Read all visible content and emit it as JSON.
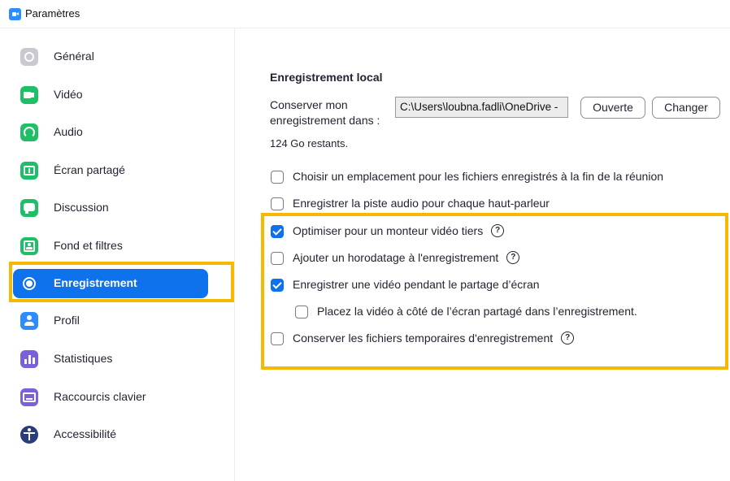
{
  "window": {
    "title": "Paramètres"
  },
  "sidebar": {
    "items": [
      {
        "label": "Général",
        "icon": "gear-icon",
        "color": "#c9c9cf"
      },
      {
        "label": "Vidéo",
        "icon": "video-camera-icon",
        "color": "#1fbf68"
      },
      {
        "label": "Audio",
        "icon": "headphones-icon",
        "color": "#1fbf68"
      },
      {
        "label": "Écran partagé",
        "icon": "share-screen-icon",
        "color": "#1fbf68"
      },
      {
        "label": "Discussion",
        "icon": "chat-bubble-icon",
        "color": "#1fbf68"
      },
      {
        "label": "Fond et filtres",
        "icon": "background-person-icon",
        "color": "#1fbf68"
      },
      {
        "label": "Enregistrement",
        "icon": "record-icon",
        "color": "#0e72ed",
        "active": true
      },
      {
        "label": "Profil",
        "icon": "profile-icon",
        "color": "#2d8cff"
      },
      {
        "label": "Statistiques",
        "icon": "statistics-icon",
        "color": "#7b61d9"
      },
      {
        "label": "Raccourcis clavier",
        "icon": "keyboard-icon",
        "color": "#7b61d9"
      },
      {
        "label": "Accessibilité",
        "icon": "accessibility-icon",
        "color": "#2a3c7a"
      }
    ]
  },
  "recording": {
    "section_title": "Enregistrement local",
    "save_location_label": "Conserver mon enregistrement dans :",
    "save_path": "C:\\Users\\loubna.fadli\\OneDrive -",
    "open_button": "Ouverte",
    "change_button": "Changer",
    "space_remaining": "124 Go restants.",
    "options": [
      {
        "label": "Choisir un emplacement pour les fichiers enregistrés à la fin de la réunion",
        "checked": false,
        "help": false
      },
      {
        "label": "Enregistrer la piste audio pour chaque haut-parleur",
        "checked": false,
        "help": false
      },
      {
        "label": "Optimiser pour un monteur vidéo tiers",
        "checked": true,
        "help": true
      },
      {
        "label": "Ajouter un horodatage à l'enregistrement",
        "checked": false,
        "help": true
      },
      {
        "label": "Enregistrer une vidéo pendant le partage d’écran",
        "checked": true,
        "help": false
      },
      {
        "label": "Placez la vidéo à côté de l’écran partagé dans l’enregistrement.",
        "checked": false,
        "help": false
      },
      {
        "label": "Conserver les fichiers temporaires d'enregistrement",
        "checked": false,
        "help": true
      }
    ],
    "help_glyph": "?"
  },
  "colors": {
    "accent": "#0e72ed",
    "highlight": "#f6b800",
    "icon_green": "#1fbf68"
  }
}
